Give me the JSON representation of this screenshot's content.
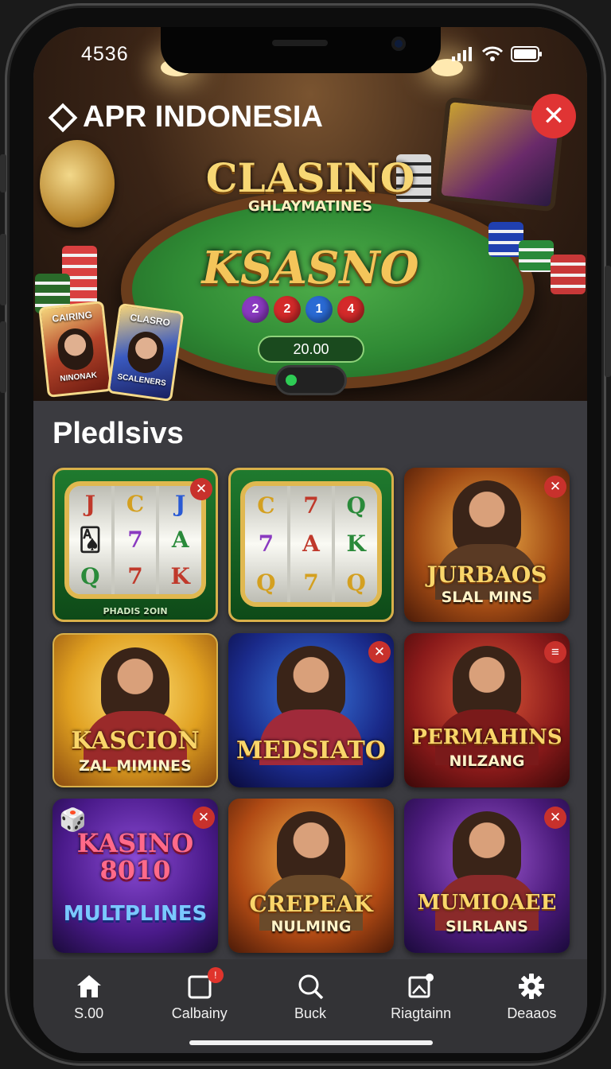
{
  "status_bar": {
    "time": "4536"
  },
  "hero": {
    "brand": "APR INDONESIA",
    "title": "CLASINO",
    "subtitle": "GHLAYMATINES",
    "title2": "KSASNO",
    "balls": [
      "2",
      "2",
      "1",
      "4"
    ],
    "amount": "20.00",
    "card_left": "CAIRING",
    "card_left_sub": "NINONAK",
    "card_right": "CLASRO",
    "card_right_sub": "SCALENERS",
    "close_icon": "close-icon",
    "colors": {
      "accent_red": "#e03434",
      "felt_green": "#2f8a34",
      "gold": "#f4c55a"
    }
  },
  "section": {
    "title": "Pledlsivs"
  },
  "tiles": [
    {
      "title": "",
      "subtitle": "PHADIS 2OIN",
      "type": "slot",
      "reels": [
        "J",
        "C",
        "J",
        "A",
        "7",
        "A"
      ]
    },
    {
      "title": "",
      "subtitle": "",
      "type": "slot",
      "reels": [
        "C",
        "7",
        "Q",
        "7",
        "A",
        "K"
      ]
    },
    {
      "title": "JURBAOS",
      "subtitle": "SLAL MINS",
      "type": "person"
    },
    {
      "title": "KASCION",
      "subtitle": "ZAL MIMINES",
      "type": "person"
    },
    {
      "title": "MEDSIATO",
      "subtitle": "",
      "type": "person"
    },
    {
      "title": "PERMAHINS",
      "subtitle": "NILZANG",
      "type": "person"
    },
    {
      "title": "KASINO 8010",
      "subtitle": "MULTPLINES",
      "type": "text"
    },
    {
      "title": "CREPEAK",
      "subtitle": "NULMING",
      "type": "person"
    },
    {
      "title": "MUMIOAEE",
      "subtitle": "SILRLANS",
      "type": "person"
    }
  ],
  "nav": [
    {
      "label": "S.00",
      "icon": "home-icon"
    },
    {
      "label": "Calbainy",
      "icon": "calendar-icon",
      "badge": "!"
    },
    {
      "label": "Buck",
      "icon": "search-icon"
    },
    {
      "label": "Riagtainn",
      "icon": "image-edit-icon"
    },
    {
      "label": "Deaaos",
      "icon": "gear-icon"
    }
  ]
}
